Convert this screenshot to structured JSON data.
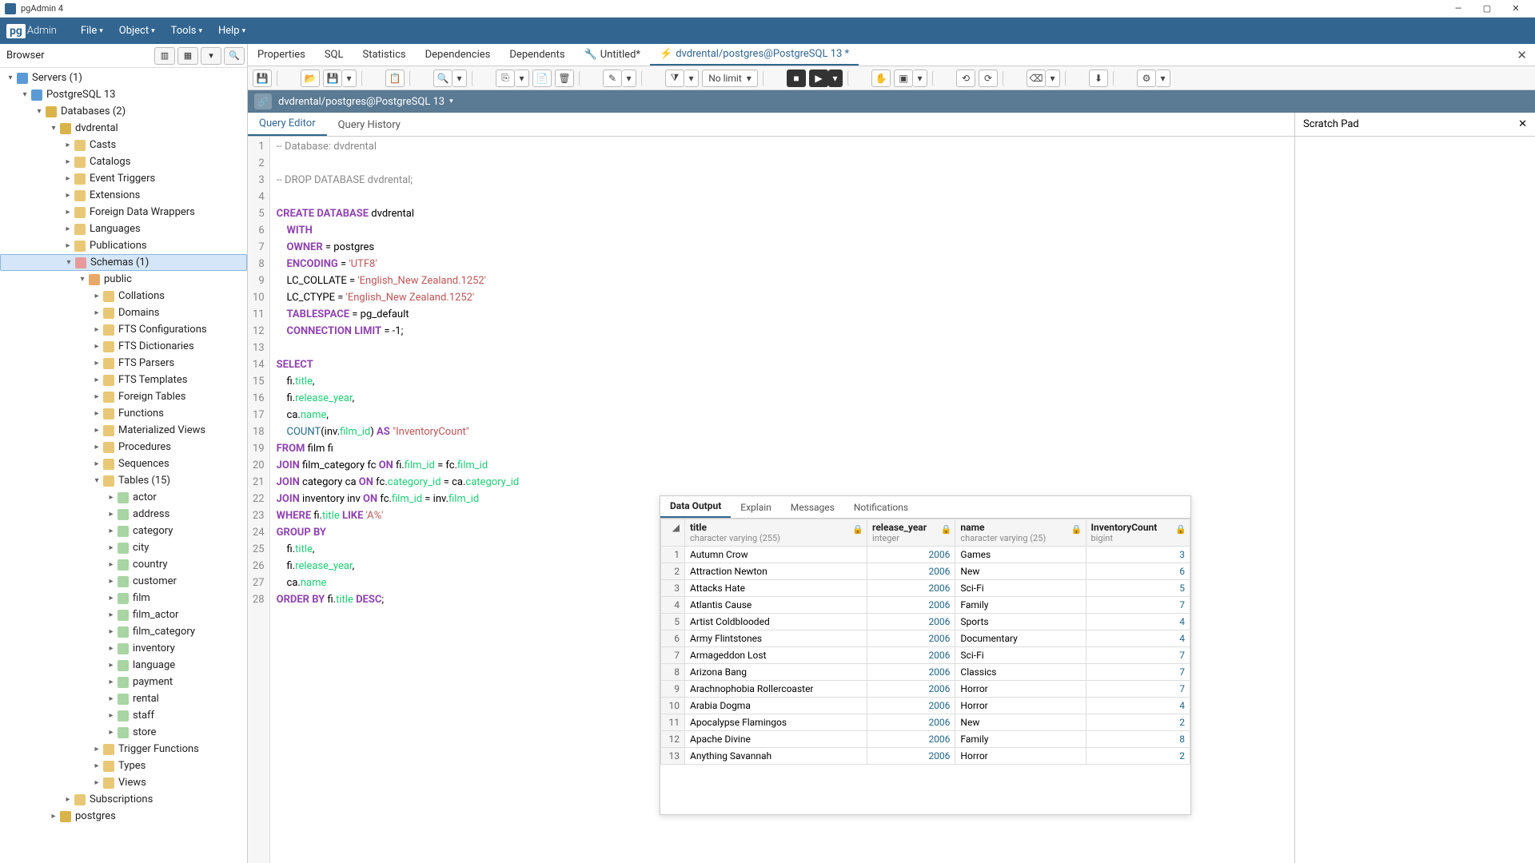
{
  "window": {
    "title": "pgAdmin 4"
  },
  "menubar": {
    "logo_pg": "pg",
    "logo_admin": "Admin",
    "items": [
      "File",
      "Object",
      "Tools",
      "Help"
    ]
  },
  "browser": {
    "title": "Browser",
    "tree": [
      {
        "d": 0,
        "arrow": "▾",
        "icon": "server",
        "label": "Servers (1)"
      },
      {
        "d": 1,
        "arrow": "▾",
        "icon": "server",
        "label": "PostgreSQL 13"
      },
      {
        "d": 2,
        "arrow": "▾",
        "icon": "db",
        "label": "Databases (2)"
      },
      {
        "d": 3,
        "arrow": "▾",
        "icon": "db",
        "label": "dvdrental"
      },
      {
        "d": 4,
        "arrow": "▸",
        "icon": "folder",
        "label": "Casts"
      },
      {
        "d": 4,
        "arrow": "▸",
        "icon": "folder",
        "label": "Catalogs"
      },
      {
        "d": 4,
        "arrow": "▸",
        "icon": "folder",
        "label": "Event Triggers"
      },
      {
        "d": 4,
        "arrow": "▸",
        "icon": "folder",
        "label": "Extensions"
      },
      {
        "d": 4,
        "arrow": "▸",
        "icon": "folder",
        "label": "Foreign Data Wrappers"
      },
      {
        "d": 4,
        "arrow": "▸",
        "icon": "folder",
        "label": "Languages"
      },
      {
        "d": 4,
        "arrow": "▸",
        "icon": "folder",
        "label": "Publications"
      },
      {
        "d": 4,
        "arrow": "▾",
        "icon": "schema",
        "label": "Schemas (1)",
        "selected": true
      },
      {
        "d": 5,
        "arrow": "▾",
        "icon": "public",
        "label": "public"
      },
      {
        "d": 6,
        "arrow": "▸",
        "icon": "folder",
        "label": "Collations"
      },
      {
        "d": 6,
        "arrow": "▸",
        "icon": "folder",
        "label": "Domains"
      },
      {
        "d": 6,
        "arrow": "▸",
        "icon": "folder",
        "label": "FTS Configurations"
      },
      {
        "d": 6,
        "arrow": "▸",
        "icon": "folder",
        "label": "FTS Dictionaries"
      },
      {
        "d": 6,
        "arrow": "▸",
        "icon": "folder",
        "label": "FTS Parsers"
      },
      {
        "d": 6,
        "arrow": "▸",
        "icon": "folder",
        "label": "FTS Templates"
      },
      {
        "d": 6,
        "arrow": "▸",
        "icon": "folder",
        "label": "Foreign Tables"
      },
      {
        "d": 6,
        "arrow": "▸",
        "icon": "folder",
        "label": "Functions"
      },
      {
        "d": 6,
        "arrow": "▸",
        "icon": "folder",
        "label": "Materialized Views"
      },
      {
        "d": 6,
        "arrow": "▸",
        "icon": "folder",
        "label": "Procedures"
      },
      {
        "d": 6,
        "arrow": "▸",
        "icon": "folder",
        "label": "Sequences"
      },
      {
        "d": 6,
        "arrow": "▾",
        "icon": "folder",
        "label": "Tables (15)"
      },
      {
        "d": 7,
        "arrow": "▸",
        "icon": "table",
        "label": "actor"
      },
      {
        "d": 7,
        "arrow": "▸",
        "icon": "table",
        "label": "address"
      },
      {
        "d": 7,
        "arrow": "▸",
        "icon": "table",
        "label": "category"
      },
      {
        "d": 7,
        "arrow": "▸",
        "icon": "table",
        "label": "city"
      },
      {
        "d": 7,
        "arrow": "▸",
        "icon": "table",
        "label": "country"
      },
      {
        "d": 7,
        "arrow": "▸",
        "icon": "table",
        "label": "customer"
      },
      {
        "d": 7,
        "arrow": "▸",
        "icon": "table",
        "label": "film"
      },
      {
        "d": 7,
        "arrow": "▸",
        "icon": "table",
        "label": "film_actor"
      },
      {
        "d": 7,
        "arrow": "▸",
        "icon": "table",
        "label": "film_category"
      },
      {
        "d": 7,
        "arrow": "▸",
        "icon": "table",
        "label": "inventory"
      },
      {
        "d": 7,
        "arrow": "▸",
        "icon": "table",
        "label": "language"
      },
      {
        "d": 7,
        "arrow": "▸",
        "icon": "table",
        "label": "payment"
      },
      {
        "d": 7,
        "arrow": "▸",
        "icon": "table",
        "label": "rental"
      },
      {
        "d": 7,
        "arrow": "▸",
        "icon": "table",
        "label": "staff"
      },
      {
        "d": 7,
        "arrow": "▸",
        "icon": "table",
        "label": "store"
      },
      {
        "d": 6,
        "arrow": "▸",
        "icon": "folder",
        "label": "Trigger Functions"
      },
      {
        "d": 6,
        "arrow": "▸",
        "icon": "folder",
        "label": "Types"
      },
      {
        "d": 6,
        "arrow": "▸",
        "icon": "folder",
        "label": "Views"
      },
      {
        "d": 4,
        "arrow": "▸",
        "icon": "folder",
        "label": "Subscriptions"
      },
      {
        "d": 3,
        "arrow": "▸",
        "icon": "db",
        "label": "postgres"
      }
    ]
  },
  "content_tabs": {
    "items": [
      "Properties",
      "SQL",
      "Statistics",
      "Dependencies",
      "Dependents"
    ],
    "untitled": "Untitled*",
    "active": "dvdrental/postgres@PostgreSQL 13 *"
  },
  "toolbar": {
    "nolimit": "No limit"
  },
  "connection": {
    "label": "dvdrental/postgres@PostgreSQL 13"
  },
  "editor_subtabs": {
    "query_editor": "Query Editor",
    "query_history": "Query History"
  },
  "scratch": {
    "title": "Scratch Pad"
  },
  "sql": [
    {
      "n": 1,
      "html": "<span class='cm'>-- Database: dvdrental</span>"
    },
    {
      "n": 2,
      "html": ""
    },
    {
      "n": 3,
      "html": "<span class='cm'>-- DROP DATABASE dvdrental;</span>"
    },
    {
      "n": 4,
      "html": ""
    },
    {
      "n": 5,
      "html": "<span class='kw'>CREATE DATABASE</span> dvdrental"
    },
    {
      "n": 6,
      "html": "    <span class='kw'>WITH</span>"
    },
    {
      "n": 7,
      "html": "    <span class='kw'>OWNER</span> = postgres"
    },
    {
      "n": 8,
      "html": "    <span class='kw'>ENCODING</span> = <span class='str'>'UTF8'</span>"
    },
    {
      "n": 9,
      "html": "    LC_COLLATE = <span class='str'>'English_New Zealand.1252'</span>"
    },
    {
      "n": 10,
      "html": "    LC_CTYPE = <span class='str'>'English_New Zealand.1252'</span>"
    },
    {
      "n": 11,
      "html": "    <span class='kw'>TABLESPACE</span> = pg_default"
    },
    {
      "n": 12,
      "html": "    <span class='kw'>CONNECTION LIMIT</span> = -1;"
    },
    {
      "n": 13,
      "html": ""
    },
    {
      "n": 14,
      "html": "<span class='kw'>SELECT</span>"
    },
    {
      "n": 15,
      "html": "    fi.<span class='id'>title</span>,"
    },
    {
      "n": 16,
      "html": "    fi.<span class='id'>release_year</span>,"
    },
    {
      "n": 17,
      "html": "    ca.<span class='id'>name</span>,"
    },
    {
      "n": 18,
      "html": "    <span class='fn'>COUNT</span>(inv.<span class='id'>film_id</span>) <span class='kw'>AS</span> <span class='str'>\"InventoryCount\"</span>"
    },
    {
      "n": 19,
      "html": "<span class='kw'>FROM</span> film fi"
    },
    {
      "n": 20,
      "html": "<span class='kw'>JOIN</span> film_category fc <span class='kw'>ON</span> fi.<span class='id'>film_id</span> = fc.<span class='id'>film_id</span>"
    },
    {
      "n": 21,
      "html": "<span class='kw'>JOIN</span> category ca <span class='kw'>ON</span> fc.<span class='id'>category_id</span> = ca.<span class='id'>category_id</span>"
    },
    {
      "n": 22,
      "html": "<span class='kw'>JOIN</span> inventory inv <span class='kw'>ON</span> fc.<span class='id'>film_id</span> = inv.<span class='id'>film_id</span>"
    },
    {
      "n": 23,
      "html": "<span class='kw'>WHERE</span> fi.<span class='id'>title</span> <span class='kw'>LIKE</span> <span class='str'>'A%'</span>"
    },
    {
      "n": 24,
      "html": "<span class='kw'>GROUP BY</span>"
    },
    {
      "n": 25,
      "html": "    fi.<span class='id'>title</span>,"
    },
    {
      "n": 26,
      "html": "    fi.<span class='id'>release_year</span>,"
    },
    {
      "n": 27,
      "html": "    ca.<span class='id'>name</span>"
    },
    {
      "n": 28,
      "html": "<span class='kw'>ORDER BY</span> fi.<span class='id'>title</span> <span class='kw'>DESC</span>;"
    }
  ],
  "output": {
    "tabs": [
      "Data Output",
      "Explain",
      "Messages",
      "Notifications"
    ],
    "columns": [
      {
        "name": "title",
        "type": "character varying (255)"
      },
      {
        "name": "release_year",
        "type": "integer"
      },
      {
        "name": "name",
        "type": "character varying (25)"
      },
      {
        "name": "InventoryCount",
        "type": "bigint"
      }
    ],
    "rows": [
      {
        "n": 1,
        "title": "Autumn Crow",
        "year": 2006,
        "name": "Games",
        "count": 3
      },
      {
        "n": 2,
        "title": "Attraction Newton",
        "year": 2006,
        "name": "New",
        "count": 6
      },
      {
        "n": 3,
        "title": "Attacks Hate",
        "year": 2006,
        "name": "Sci-Fi",
        "count": 5
      },
      {
        "n": 4,
        "title": "Atlantis Cause",
        "year": 2006,
        "name": "Family",
        "count": 7
      },
      {
        "n": 5,
        "title": "Artist Coldblooded",
        "year": 2006,
        "name": "Sports",
        "count": 4
      },
      {
        "n": 6,
        "title": "Army Flintstones",
        "year": 2006,
        "name": "Documentary",
        "count": 4
      },
      {
        "n": 7,
        "title": "Armageddon Lost",
        "year": 2006,
        "name": "Sci-Fi",
        "count": 7
      },
      {
        "n": 8,
        "title": "Arizona Bang",
        "year": 2006,
        "name": "Classics",
        "count": 7
      },
      {
        "n": 9,
        "title": "Arachnophobia Rollercoaster",
        "year": 2006,
        "name": "Horror",
        "count": 7
      },
      {
        "n": 10,
        "title": "Arabia Dogma",
        "year": 2006,
        "name": "Horror",
        "count": 4
      },
      {
        "n": 11,
        "title": "Apocalypse Flamingos",
        "year": 2006,
        "name": "New",
        "count": 2
      },
      {
        "n": 12,
        "title": "Apache Divine",
        "year": 2006,
        "name": "Family",
        "count": 8
      },
      {
        "n": 13,
        "title": "Anything Savannah",
        "year": 2006,
        "name": "Horror",
        "count": 2
      }
    ]
  }
}
